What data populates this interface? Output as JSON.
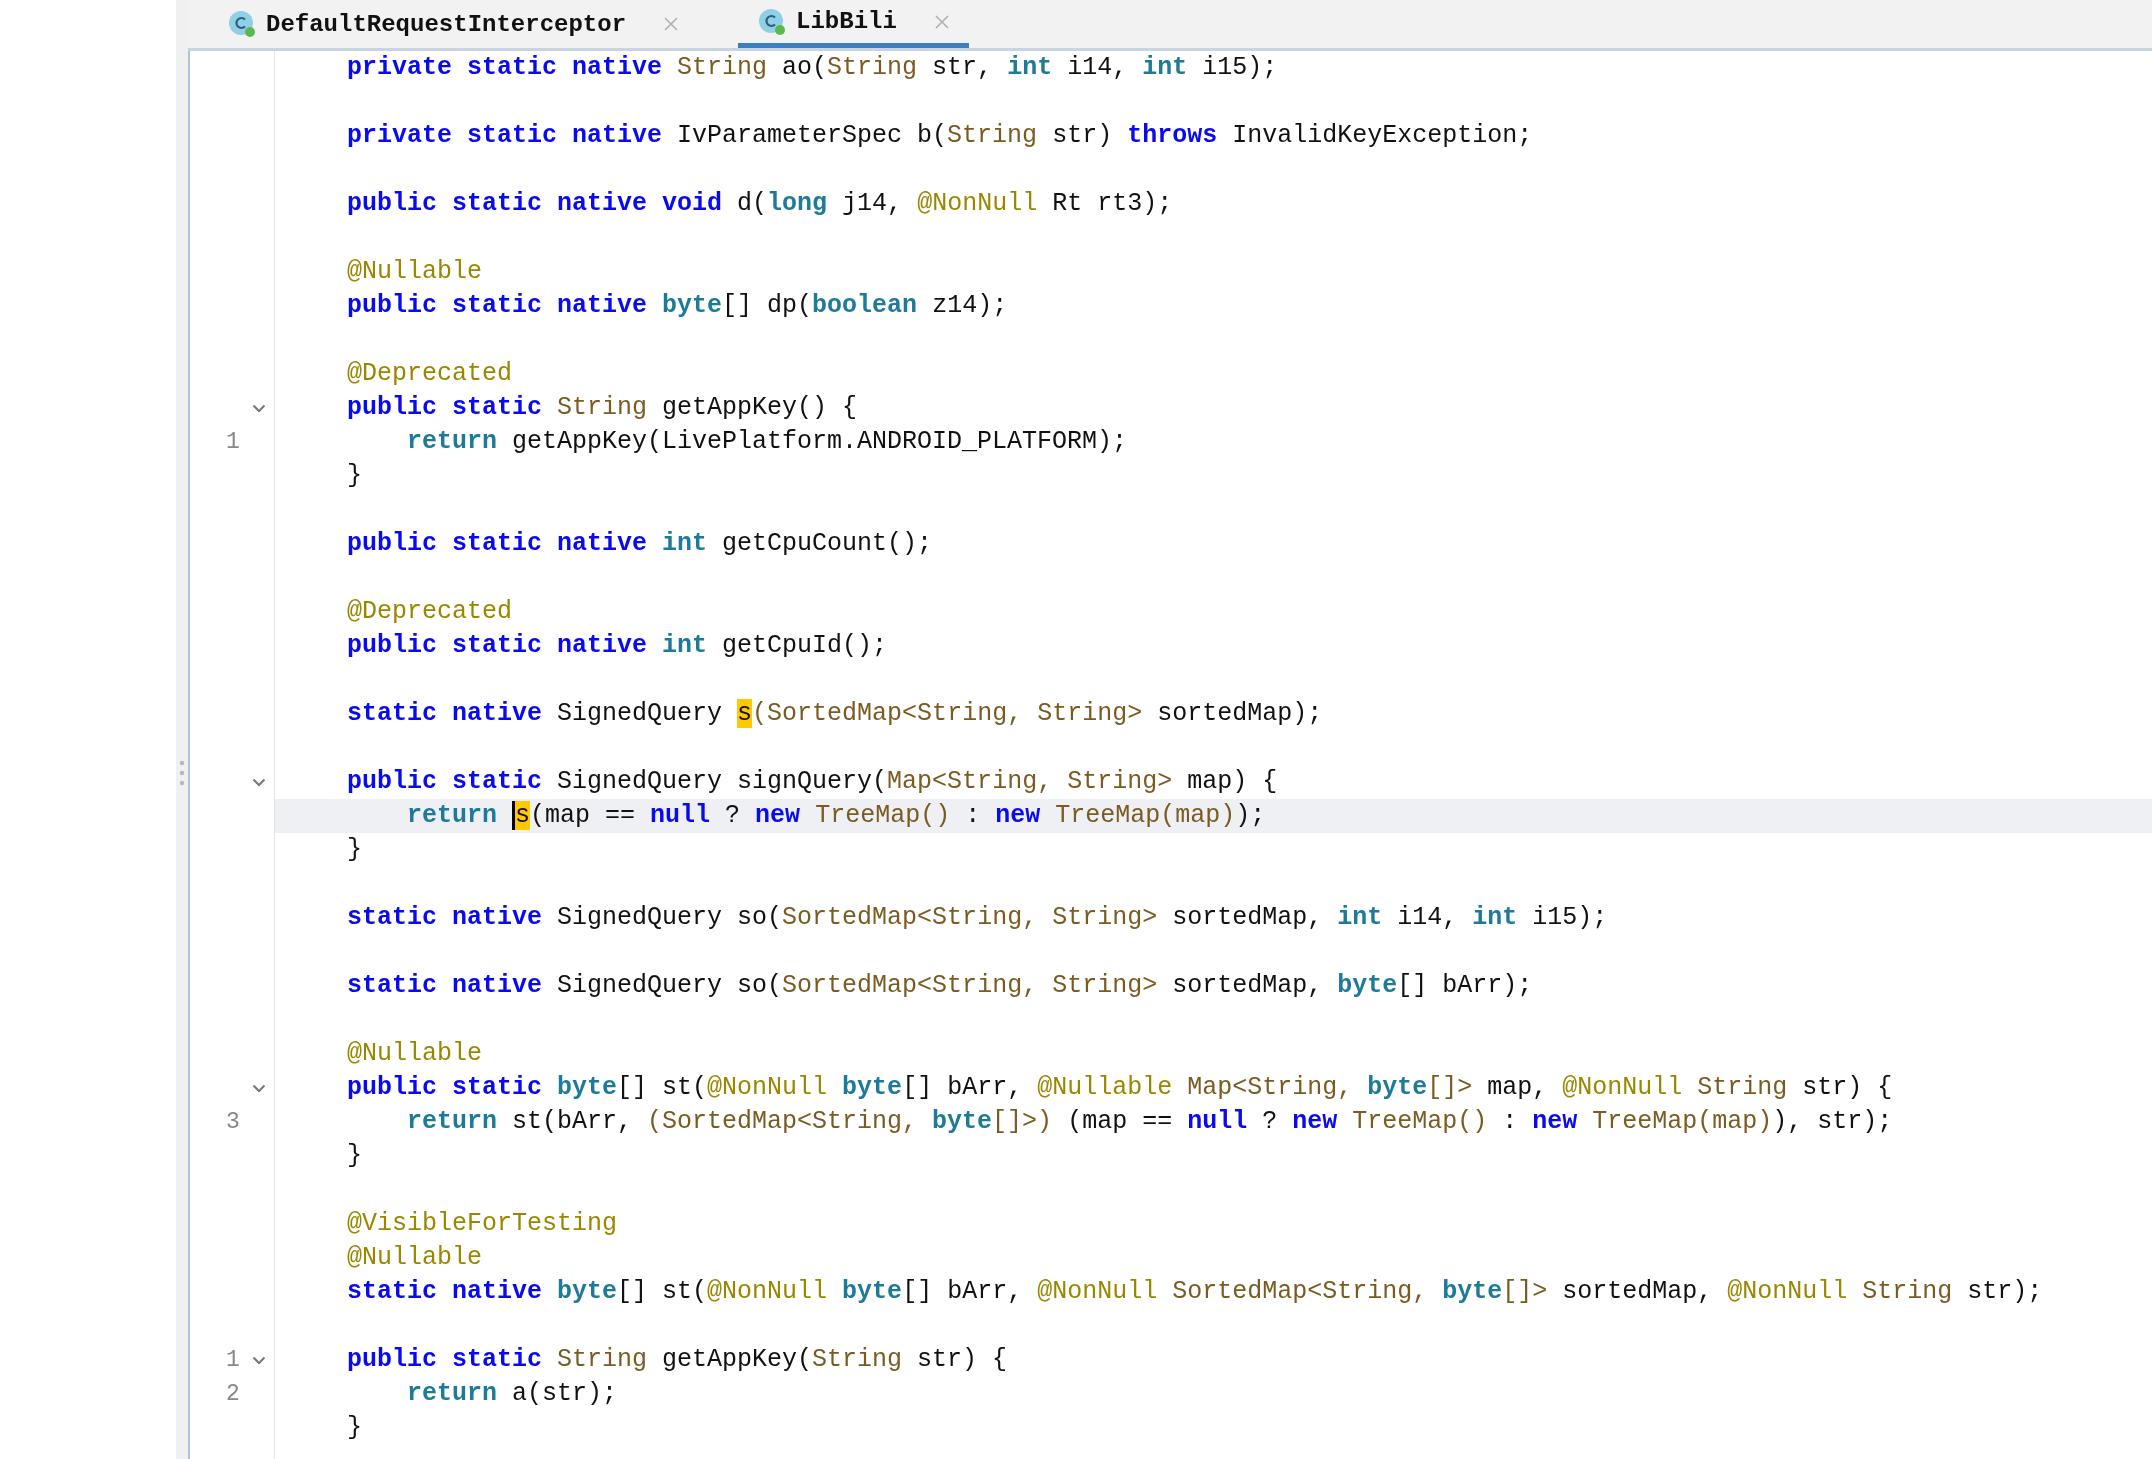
{
  "tabs": [
    {
      "label": "DefaultRequestInterceptor",
      "selected": false
    },
    {
      "label": "LibBili",
      "selected": true
    }
  ],
  "blocks": [
    {
      "lines": [
        {
          "fold": false,
          "current": false,
          "tokens": [
            {
              "kind": "keyword",
              "text": "private static native "
            },
            {
              "kind": "type",
              "text": "String"
            },
            {
              "kind": "plain",
              "text": " ao("
            },
            {
              "kind": "type",
              "text": "String"
            },
            {
              "kind": "plain",
              "text": " str, "
            },
            {
              "kind": "primitive",
              "text": "int"
            },
            {
              "kind": "plain",
              "text": " i14, "
            },
            {
              "kind": "primitive",
              "text": "int"
            },
            {
              "kind": "plain",
              "text": " i15);"
            }
          ]
        }
      ]
    },
    {
      "lines": [
        {
          "fold": false,
          "current": false,
          "tokens": [
            {
              "kind": "keyword",
              "text": "private static native "
            },
            {
              "kind": "plain",
              "text": "IvParameterSpec b("
            },
            {
              "kind": "type",
              "text": "String"
            },
            {
              "kind": "plain",
              "text": " str) "
            },
            {
              "kind": "keyword",
              "text": "throws"
            },
            {
              "kind": "plain",
              "text": " InvalidKeyException;"
            }
          ]
        }
      ]
    },
    {
      "lines": [
        {
          "fold": false,
          "current": false,
          "tokens": [
            {
              "kind": "keyword",
              "text": "public static native void "
            },
            {
              "kind": "plain",
              "text": "d("
            },
            {
              "kind": "primitive",
              "text": "long"
            },
            {
              "kind": "plain",
              "text": " j14, "
            },
            {
              "kind": "annotation",
              "text": "@NonNull"
            },
            {
              "kind": "plain",
              "text": " Rt rt3);"
            }
          ]
        }
      ]
    },
    {
      "lines": [
        {
          "fold": false,
          "current": false,
          "tokens": [
            {
              "kind": "annotation",
              "text": "@Nullable"
            }
          ]
        },
        {
          "fold": false,
          "current": false,
          "tokens": [
            {
              "kind": "keyword",
              "text": "public static native "
            },
            {
              "kind": "primitive",
              "text": "byte"
            },
            {
              "kind": "plain",
              "text": "[] dp("
            },
            {
              "kind": "primitive",
              "text": "boolean"
            },
            {
              "kind": "plain",
              "text": " z14);"
            }
          ]
        }
      ]
    },
    {
      "lines": [
        {
          "fold": false,
          "current": false,
          "tokens": [
            {
              "kind": "annotation",
              "text": "@Deprecated"
            }
          ]
        },
        {
          "fold": true,
          "current": false,
          "tokens": [
            {
              "kind": "keyword",
              "text": "public static "
            },
            {
              "kind": "type",
              "text": "String"
            },
            {
              "kind": "plain",
              "text": " getAppKey() {"
            }
          ],
          "children": [
            {
              "gutter": "1",
              "fold": false,
              "current": false,
              "tokens": [
                {
                  "kind": "primitive",
                  "text": "return"
                },
                {
                  "kind": "plain",
                  "text": " getAppKey(LivePlatform.ANDROID_PLATFORM);"
                }
              ]
            }
          ]
        },
        {
          "fold": false,
          "current": false,
          "tokens": [
            {
              "kind": "plain",
              "text": "}"
            }
          ]
        }
      ]
    },
    {
      "lines": [
        {
          "fold": false,
          "current": false,
          "tokens": [
            {
              "kind": "keyword",
              "text": "public static native "
            },
            {
              "kind": "primitive",
              "text": "int"
            },
            {
              "kind": "plain",
              "text": " getCpuCount();"
            }
          ]
        }
      ]
    },
    {
      "lines": [
        {
          "fold": false,
          "current": false,
          "tokens": [
            {
              "kind": "annotation",
              "text": "@Deprecated"
            }
          ]
        },
        {
          "fold": false,
          "current": false,
          "tokens": [
            {
              "kind": "keyword",
              "text": "public static native "
            },
            {
              "kind": "primitive",
              "text": "int"
            },
            {
              "kind": "plain",
              "text": " getCpuId();"
            }
          ]
        }
      ]
    },
    {
      "lines": [
        {
          "fold": false,
          "current": false,
          "tokens": [
            {
              "kind": "keyword",
              "text": "static native "
            },
            {
              "kind": "plain",
              "text": "SignedQuery "
            },
            {
              "kind": "match",
              "text": "s"
            },
            {
              "kind": "type",
              "text": "(SortedMap<String, String>"
            },
            {
              "kind": "plain",
              "text": " sortedMap);"
            }
          ]
        }
      ]
    },
    {
      "lines": [
        {
          "fold": true,
          "current": false,
          "tokens": [
            {
              "kind": "keyword",
              "text": "public static "
            },
            {
              "kind": "plain",
              "text": "SignedQuery signQuery("
            },
            {
              "kind": "type",
              "text": "Map<String, String>"
            },
            {
              "kind": "plain",
              "text": " map) {"
            }
          ],
          "children": [
            {
              "fold": false,
              "current": true,
              "tokens": [
                {
                  "kind": "primitive",
                  "text": "return "
                },
                {
                  "kind": "caret",
                  "text": "s"
                },
                {
                  "kind": "plain",
                  "text": "(map == "
                },
                {
                  "kind": "keyword",
                  "text": "null"
                },
                {
                  "kind": "plain",
                  "text": " ? "
                },
                {
                  "kind": "keyword",
                  "text": "new"
                },
                {
                  "kind": "type",
                  "text": " TreeMap()"
                },
                {
                  "kind": "plain",
                  "text": " : "
                },
                {
                  "kind": "keyword",
                  "text": "new"
                },
                {
                  "kind": "type",
                  "text": " TreeMap(map)"
                },
                {
                  "kind": "plain",
                  "text": ");"
                }
              ]
            }
          ]
        },
        {
          "fold": false,
          "current": false,
          "tokens": [
            {
              "kind": "plain",
              "text": "}"
            }
          ]
        }
      ]
    },
    {
      "lines": [
        {
          "fold": false,
          "current": false,
          "tokens": [
            {
              "kind": "keyword",
              "text": "static native "
            },
            {
              "kind": "plain",
              "text": "SignedQuery so("
            },
            {
              "kind": "type",
              "text": "SortedMap<String, String>"
            },
            {
              "kind": "plain",
              "text": " sortedMap, "
            },
            {
              "kind": "primitive",
              "text": "int"
            },
            {
              "kind": "plain",
              "text": " i14, "
            },
            {
              "kind": "primitive",
              "text": "int"
            },
            {
              "kind": "plain",
              "text": " i15);"
            }
          ]
        }
      ]
    },
    {
      "lines": [
        {
          "fold": false,
          "current": false,
          "tokens": [
            {
              "kind": "keyword",
              "text": "static native "
            },
            {
              "kind": "plain",
              "text": "SignedQuery so("
            },
            {
              "kind": "type",
              "text": "SortedMap<String, String>"
            },
            {
              "kind": "plain",
              "text": " sortedMap, "
            },
            {
              "kind": "primitive",
              "text": "byte"
            },
            {
              "kind": "plain",
              "text": "[] bArr);"
            }
          ]
        }
      ]
    },
    {
      "lines": [
        {
          "fold": false,
          "current": false,
          "tokens": [
            {
              "kind": "annotation",
              "text": "@Nullable"
            }
          ]
        },
        {
          "fold": true,
          "current": false,
          "tokens": [
            {
              "kind": "keyword",
              "text": "public static "
            },
            {
              "kind": "primitive",
              "text": "byte"
            },
            {
              "kind": "plain",
              "text": "[] st("
            },
            {
              "kind": "annotation",
              "text": "@NonNull "
            },
            {
              "kind": "primitive",
              "text": "byte"
            },
            {
              "kind": "plain",
              "text": "[] bArr, "
            },
            {
              "kind": "annotation",
              "text": "@Nullable"
            },
            {
              "kind": "type",
              "text": " Map<String, "
            },
            {
              "kind": "primitive",
              "text": "byte"
            },
            {
              "kind": "type",
              "text": "[]>"
            },
            {
              "kind": "plain",
              "text": " map, "
            },
            {
              "kind": "annotation",
              "text": "@NonNull"
            },
            {
              "kind": "type",
              "text": " String"
            },
            {
              "kind": "plain",
              "text": " str) {"
            }
          ],
          "children": [
            {
              "gutter": "3",
              "fold": false,
              "current": false,
              "tokens": [
                {
                  "kind": "primitive",
                  "text": "return"
                },
                {
                  "kind": "plain",
                  "text": " st(bArr, "
                },
                {
                  "kind": "type",
                  "text": "(SortedMap<String, "
                },
                {
                  "kind": "primitive",
                  "text": "byte"
                },
                {
                  "kind": "type",
                  "text": "[]>)"
                },
                {
                  "kind": "plain",
                  "text": " (map == "
                },
                {
                  "kind": "keyword",
                  "text": "null"
                },
                {
                  "kind": "plain",
                  "text": " ? "
                },
                {
                  "kind": "keyword",
                  "text": "new"
                },
                {
                  "kind": "type",
                  "text": " TreeMap()"
                },
                {
                  "kind": "plain",
                  "text": " : "
                },
                {
                  "kind": "keyword",
                  "text": "new"
                },
                {
                  "kind": "type",
                  "text": " TreeMap(map)"
                },
                {
                  "kind": "plain",
                  "text": "), str);"
                }
              ]
            }
          ]
        },
        {
          "fold": false,
          "current": false,
          "tokens": [
            {
              "kind": "plain",
              "text": "}"
            }
          ]
        }
      ]
    },
    {
      "lines": [
        {
          "fold": false,
          "current": false,
          "tokens": [
            {
              "kind": "annotation",
              "text": "@VisibleForTesting"
            }
          ]
        },
        {
          "fold": false,
          "current": false,
          "tokens": [
            {
              "kind": "annotation",
              "text": "@Nullable"
            }
          ]
        },
        {
          "fold": false,
          "current": false,
          "tokens": [
            {
              "kind": "keyword",
              "text": "static native "
            },
            {
              "kind": "primitive",
              "text": "byte"
            },
            {
              "kind": "plain",
              "text": "[] st("
            },
            {
              "kind": "annotation",
              "text": "@NonNull "
            },
            {
              "kind": "primitive",
              "text": "byte"
            },
            {
              "kind": "plain",
              "text": "[] bArr, "
            },
            {
              "kind": "annotation",
              "text": "@NonNull"
            },
            {
              "kind": "type",
              "text": " SortedMap<String, "
            },
            {
              "kind": "primitive",
              "text": "byte"
            },
            {
              "kind": "type",
              "text": "[]>"
            },
            {
              "kind": "plain",
              "text": " sortedMap, "
            },
            {
              "kind": "annotation",
              "text": "@NonNull"
            },
            {
              "kind": "type",
              "text": " String"
            },
            {
              "kind": "plain",
              "text": " str);"
            }
          ]
        }
      ]
    },
    {
      "lines": [
        {
          "gutter": "1",
          "fold": true,
          "current": false,
          "tokens": [
            {
              "kind": "keyword",
              "text": "public static "
            },
            {
              "kind": "type",
              "text": "String"
            },
            {
              "kind": "plain",
              "text": " getAppKey("
            },
            {
              "kind": "type",
              "text": "String"
            },
            {
              "kind": "plain",
              "text": " str) {"
            }
          ],
          "children": [
            {
              "gutter": "2",
              "fold": false,
              "current": false,
              "tokens": [
                {
                  "kind": "primitive",
                  "text": "return"
                },
                {
                  "kind": "plain",
                  "text": " a(str);"
                }
              ]
            }
          ]
        },
        {
          "fold": false,
          "current": false,
          "tokens": [
            {
              "kind": "plain",
              "text": "}"
            }
          ]
        }
      ]
    }
  ]
}
